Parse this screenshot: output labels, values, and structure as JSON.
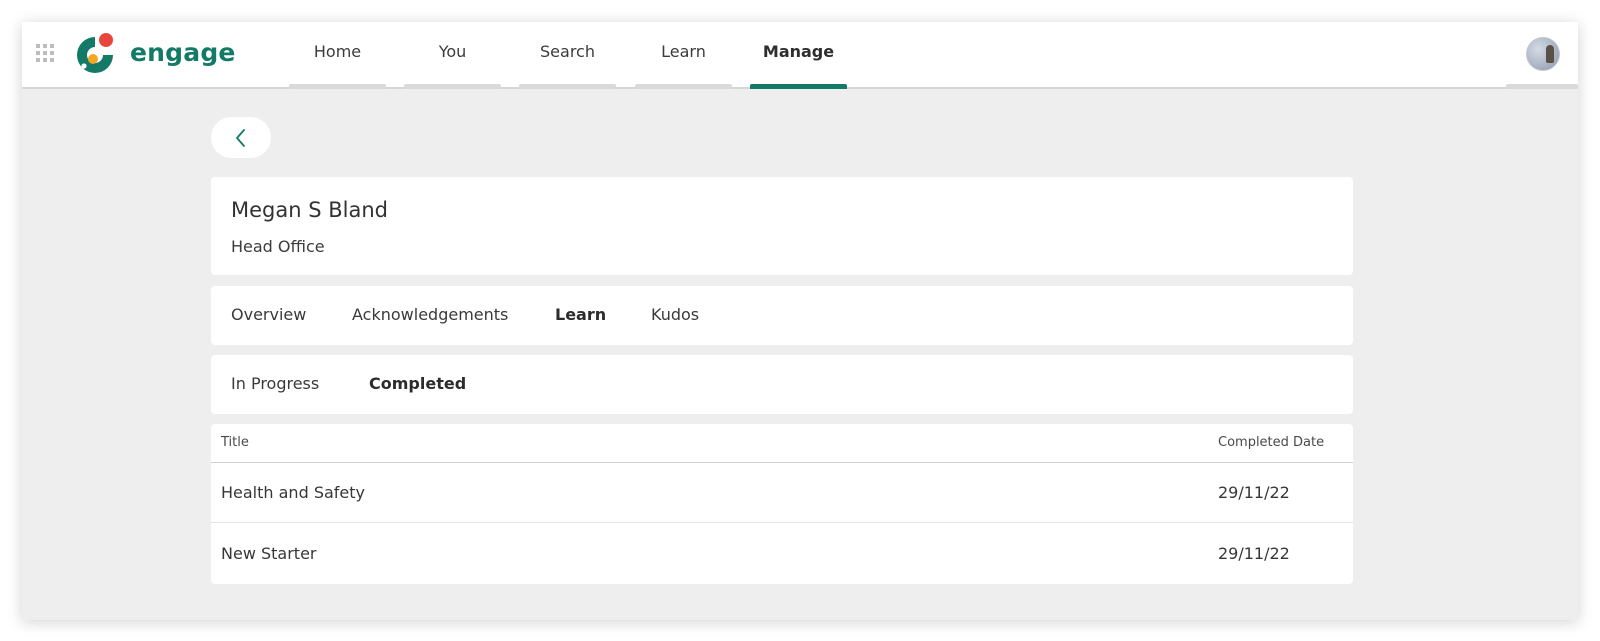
{
  "app": {
    "logo_text": "engage",
    "brand_color": "#127a66",
    "logo_dot_colors": [
      "#e8453c",
      "#f5a623"
    ]
  },
  "nav": {
    "items": [
      {
        "label": "Home"
      },
      {
        "label": "You"
      },
      {
        "label": "Search"
      },
      {
        "label": "Learn"
      },
      {
        "label": "Manage",
        "active": true
      }
    ]
  },
  "profile": {
    "name": "Megan S Bland",
    "location": "Head Office"
  },
  "tabs": {
    "items": [
      {
        "label": "Overview"
      },
      {
        "label": "Acknowledgements"
      },
      {
        "label": "Learn",
        "active": true
      },
      {
        "label": "Kudos"
      }
    ]
  },
  "subtabs": {
    "items": [
      {
        "label": "In Progress"
      },
      {
        "label": "Completed",
        "active": true
      }
    ]
  },
  "table": {
    "columns": [
      "Title",
      "Completed Date"
    ],
    "rows": [
      {
        "title": "Health and Safety",
        "date": "29/11/22"
      },
      {
        "title": "New Starter",
        "date": "29/11/22"
      }
    ]
  },
  "icons": {
    "app_launcher": "waffle-grid-icon",
    "back": "chevron-left-icon",
    "user": "avatar"
  }
}
